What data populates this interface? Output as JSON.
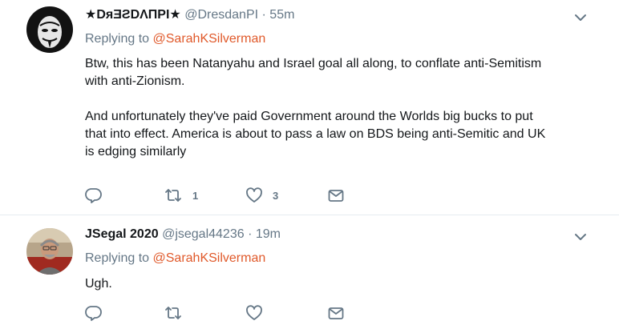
{
  "colors": {
    "mention": "#e0592a",
    "secondary": "#657786",
    "divider": "#e6ecf0",
    "icon": "#657786"
  },
  "icons": [
    "reply-icon",
    "retweet-icon",
    "like-icon",
    "direct-message-icon",
    "chevron-down-icon"
  ],
  "tweets": [
    {
      "display_name": "★DᴙƎƧDΛПPI★",
      "handle": "@DresdanPI",
      "separator": "·",
      "time": "55m",
      "replying_label": "Replying to",
      "replying_to": "@SarahKSilverman",
      "text": "Btw, this has been Natanyahu and Israel goal all along, to conflate anti-Semitism\nwith anti-Zionism.\n\nAnd unfortunately they've paid Government around the Worlds big bucks to put\nthat into effect. America is about to pass a law on BDS being anti-Semitic and UK\nis edging similarly",
      "retweets": "1",
      "likes": "3"
    },
    {
      "display_name": "JSegal 2020",
      "handle": "@jsegal44236",
      "separator": "·",
      "time": "19m",
      "replying_label": "Replying to",
      "replying_to": "@SarahKSilverman",
      "text": "Ugh.",
      "retweets": "",
      "likes": ""
    }
  ]
}
